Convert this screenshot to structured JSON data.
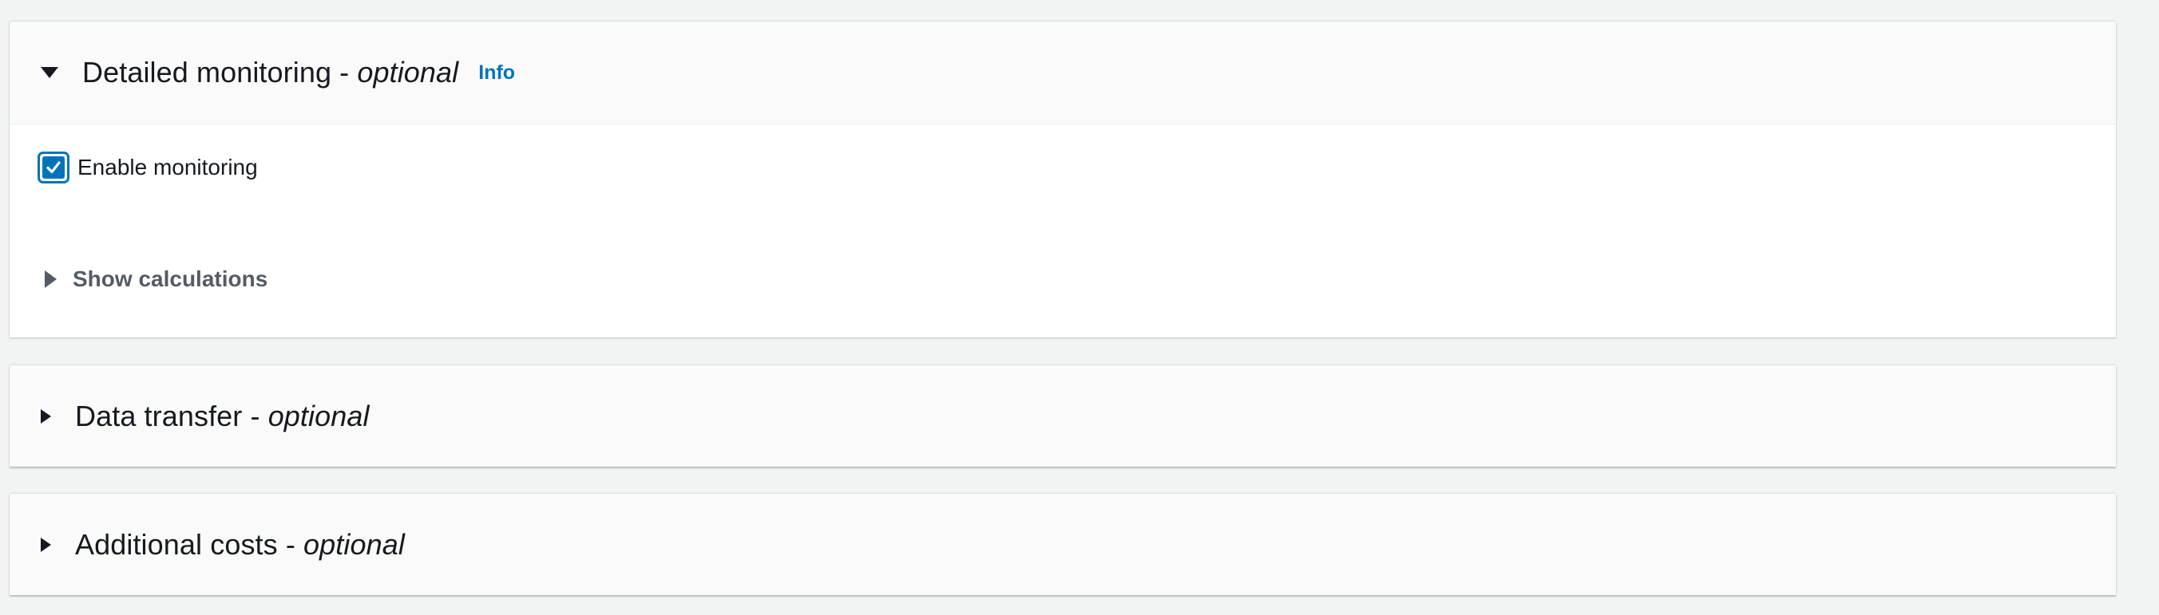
{
  "panels": [
    {
      "title": "Detailed monitoring - ",
      "optional": "optional",
      "info": "Info",
      "expanded": true,
      "checkbox": {
        "label": "Enable monitoring",
        "checked": true
      },
      "show_calculations": "Show calculations"
    },
    {
      "title": "Data transfer - ",
      "optional": "optional",
      "expanded": false
    },
    {
      "title": "Additional costs - ",
      "optional": "optional",
      "expanded": false
    }
  ],
  "colors": {
    "background": "#f2f3f3",
    "accent": "#0073bb",
    "text": "#16191f",
    "muted": "#545b64"
  }
}
